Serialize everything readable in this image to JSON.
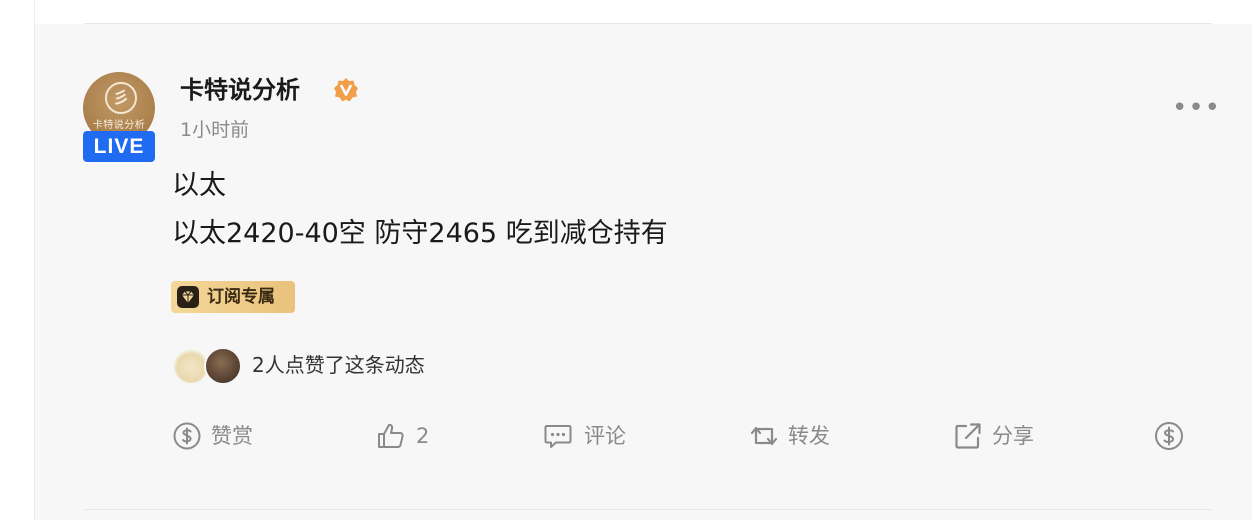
{
  "post": {
    "author": {
      "name": "卡特说分析",
      "avatar_caption": "卡特说分析",
      "avatar_glyph": "彡",
      "live_label": "LIVE",
      "verified_icon": "verified-v-badge-icon",
      "verified_color": "#f0a04b"
    },
    "time": "1小时前",
    "content": {
      "line1": "以太",
      "line2": "以太2420-40空 防守2465 吃到减仓持有"
    },
    "subscription_tag": {
      "label": "订阅专属",
      "icon": "diamond-icon"
    },
    "likes_summary": "2人点赞了这条动态",
    "actions": {
      "reward": "赞赏",
      "like_count": "2",
      "comment": "评论",
      "repost": "转发",
      "share": "分享"
    }
  },
  "colors": {
    "live_badge": "#1f6cf2",
    "card_background": "#f7f7f8",
    "muted_text": "#8a8a8a",
    "tag_gold": "#e9c27b"
  }
}
